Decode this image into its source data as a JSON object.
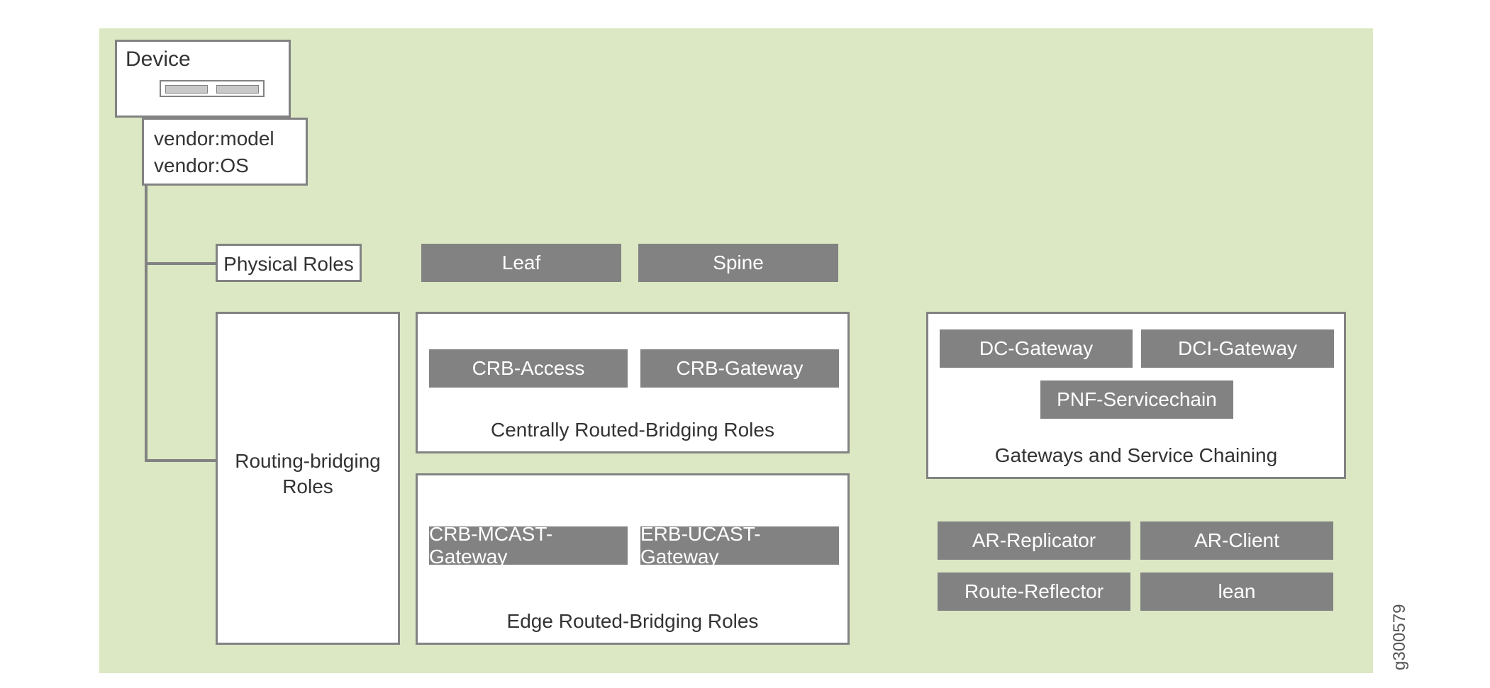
{
  "device": {
    "title": "Device",
    "vendor_model": "vendor:model",
    "vendor_os": "vendor:OS"
  },
  "physical_roles": {
    "label": "Physical Roles",
    "leaf": "Leaf",
    "spine": "Spine"
  },
  "routing_bridging": {
    "label_line1": "Routing-bridging",
    "label_line2": "Roles"
  },
  "crb_group": {
    "crb_access": "CRB-Access",
    "crb_gateway": "CRB-Gateway",
    "footer": "Centrally Routed-Bridging Roles"
  },
  "erb_group": {
    "crb_mcast": "CRB-MCAST-Gateway",
    "erb_ucast": "ERB-UCAST-Gateway",
    "footer": "Edge Routed-Bridging Roles"
  },
  "gateways_group": {
    "dc_gateway": "DC-Gateway",
    "dci_gateway": "DCI-Gateway",
    "pnf_servicechain": "PNF-Servicechain",
    "footer": "Gateways and Service Chaining"
  },
  "other_roles": {
    "ar_replicator": "AR-Replicator",
    "ar_client": "AR-Client",
    "route_reflector": "Route-Reflector",
    "lean": "lean"
  },
  "image_id": "g300579"
}
